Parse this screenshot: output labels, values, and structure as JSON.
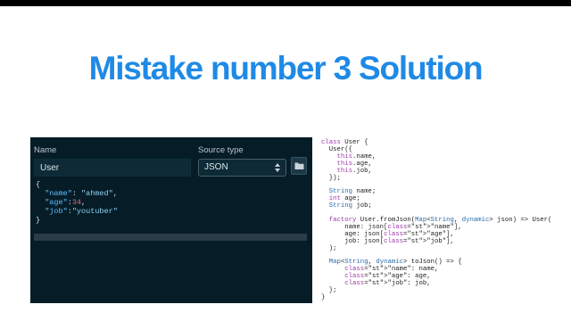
{
  "slide": {
    "title": "Mistake number 3 Solution"
  },
  "form": {
    "name_label": "Name",
    "name_value": "User",
    "source_type_label": "Source type",
    "source_type_value": "JSON",
    "folder_icon": "folder-icon",
    "select_icon": "up-down-arrows-icon"
  },
  "json_input": {
    "open": "{",
    "lines": [
      {
        "key": "\"name\"",
        "sep": ": ",
        "value": "\"ahmed\"",
        "end": ","
      },
      {
        "key": "\"age\"",
        "sep": ":",
        "value": "34",
        "end": ","
      },
      {
        "key": "\"job\"",
        "sep": ":",
        "value": "\"youtuber\"",
        "end": ""
      }
    ],
    "close": "}"
  },
  "code_output": [
    "class User {",
    "  User({",
    "    this.name,",
    "    this.age,",
    "    this.job,",
    "  });",
    "",
    "  String name;",
    "  int age;",
    "  String job;",
    "",
    "  factory User.fromJson(Map<String, dynamic> json) => User(",
    "      name: json[\"name\"],",
    "      age: json[\"age\"],",
    "      job: json[\"job\"],",
    "  );",
    "",
    "  Map<String, dynamic> toJson() => {",
    "      \"name\": name,",
    "      \"age\": age,",
    "      \"job\": job,",
    "  };",
    "}"
  ],
  "colors": {
    "title": "#1f8ae6",
    "panel_bg": "#061d28",
    "json_key": "#5dbfff",
    "json_number": "#e06c75",
    "code_keyword": "#9b39a8"
  }
}
